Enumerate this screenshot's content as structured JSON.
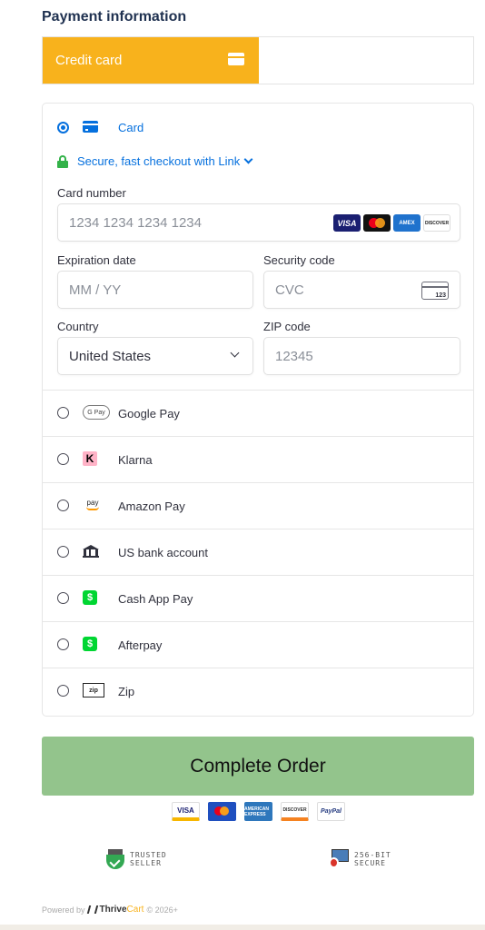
{
  "header": {
    "title": "Payment information"
  },
  "tabs": {
    "active_label": "Credit card",
    "active_icon": "card-icon"
  },
  "card_form": {
    "method_label": "Card",
    "link_text": "Secure, fast checkout with Link",
    "card_number_label": "Card number",
    "card_number_placeholder": "1234 1234 1234 1234",
    "card_brands": [
      "VISA",
      "MC",
      "AMEX",
      "DISCOVER"
    ],
    "expiration_label": "Expiration date",
    "expiration_placeholder": "MM / YY",
    "security_label": "Security code",
    "security_placeholder": "CVC",
    "cvc_icon_text": "123",
    "country_label": "Country",
    "country_value": "United States",
    "zip_label": "ZIP code",
    "zip_placeholder": "12345"
  },
  "methods": [
    {
      "label": "Google Pay",
      "icon": "google-pay-icon",
      "icon_text": "G Pay"
    },
    {
      "label": "Klarna",
      "icon": "klarna-icon",
      "icon_text": "K"
    },
    {
      "label": "Amazon Pay",
      "icon": "amazon-pay-icon",
      "icon_text": "pay"
    },
    {
      "label": "US bank account",
      "icon": "bank-icon",
      "icon_text": ""
    },
    {
      "label": "Cash App Pay",
      "icon": "cash-app-icon",
      "icon_text": "$"
    },
    {
      "label": "Afterpay",
      "icon": "afterpay-icon",
      "icon_text": "$"
    },
    {
      "label": "Zip",
      "icon": "zip-icon",
      "icon_text": "zip"
    }
  ],
  "order": {
    "button_label": "Complete Order"
  },
  "payment_logos": [
    "VISA",
    "MC",
    "AMERICAN EXPRESS",
    "DISCOVER",
    "PayPal"
  ],
  "badges": {
    "trusted_line1": "TRUSTED",
    "trusted_line2": "SELLER",
    "secure_line1": "256-BIT",
    "secure_line2": "SECURE"
  },
  "footer": {
    "powered_by": "Powered by",
    "brand_a": "Thrive",
    "brand_b": "Cart",
    "copyright": "© 2026+"
  },
  "colors": {
    "accent_tab": "#f8b21c",
    "link_blue": "#0570de",
    "button_green": "#93c48c",
    "lock_green": "#33b249"
  }
}
